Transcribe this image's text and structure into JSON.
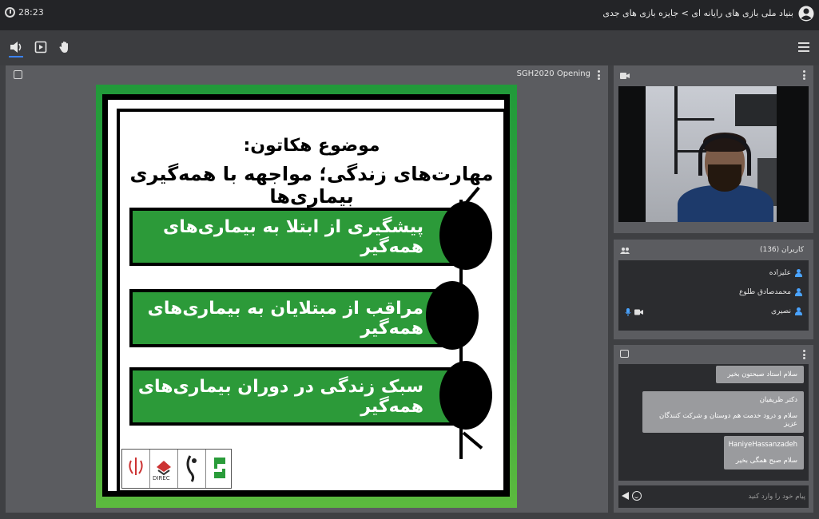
{
  "topbar": {
    "timer": "28:23",
    "breadcrumb": "بنیاد ملی بازی های رایانه ای > جایزه بازی های جدی",
    "icons": {
      "timer": "clock-icon",
      "account": "account-circle-icon"
    }
  },
  "toolbar": {
    "icons": [
      "speaker-icon",
      "present-icon",
      "raise-hand-icon",
      "menu-icon"
    ],
    "accent_color": "#3b82f6"
  },
  "presentation": {
    "title": "SGH2020 Opening",
    "slide": {
      "heading_line1": "موضوع هکاتون:",
      "heading_line2": "مهارت‌های زندگی؛ مواجهه با همه‌گیری بیماری‌ها",
      "items": [
        "پیشگیری از ابتلا به بیماری‌های همه‌گیر",
        "مراقب از مبتلایان به بیماری‌های همه‌گیر",
        "سبک زندگی در دوران بیماری‌های همه‌گیر"
      ],
      "logo_label": "DIREC",
      "green_color": "#2c9a39"
    }
  },
  "users": {
    "title": "کاربران (136)",
    "list": [
      {
        "name": "علیزاده"
      },
      {
        "name": "محمدصادق طلوع"
      },
      {
        "name": "نصیری"
      }
    ]
  },
  "chat": {
    "messages": [
      {
        "sender": "",
        "text": "سلام استاد صبحتون بخیر"
      },
      {
        "sender": "دکتر ظریفیان",
        "text": "سلام و درود خدمت هم دوستان و شرکت کنندگان عزیز"
      },
      {
        "sender": "HaniyeHassanzadeh",
        "text": "سلام صبح همگی بخیر"
      }
    ],
    "input_placeholder": "پیام خود را وارد کنید"
  }
}
